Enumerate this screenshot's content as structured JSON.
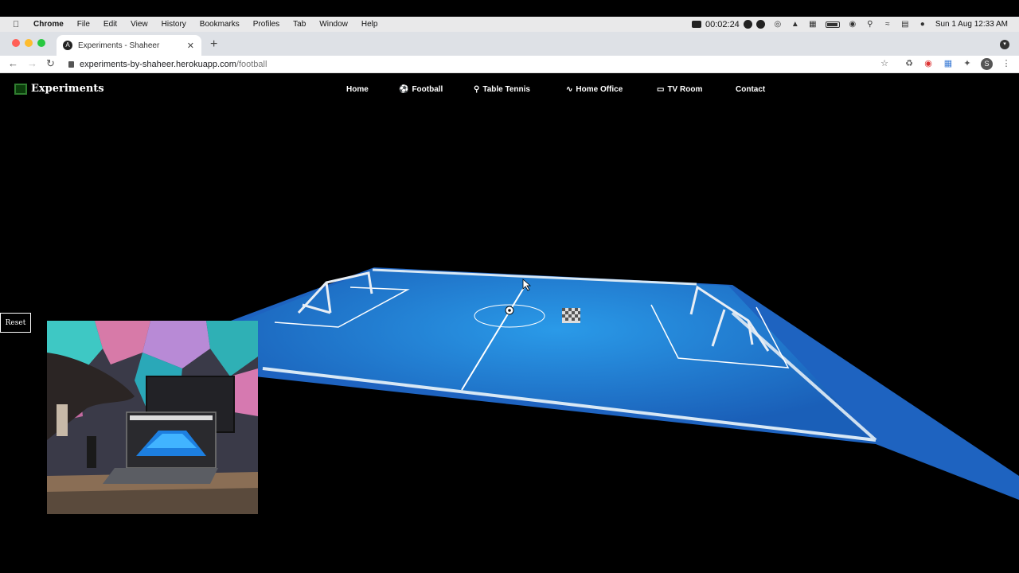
{
  "menubar": {
    "app_name": "Chrome",
    "items": [
      "File",
      "Edit",
      "View",
      "History",
      "Bookmarks",
      "Profiles",
      "Tab",
      "Window",
      "Help"
    ],
    "recording_time": "00:02:24",
    "datetime": "Sun 1 Aug  12:33 AM"
  },
  "browser": {
    "tab_title": "Experiments - Shaheer",
    "url_domain": "experiments-by-shaheer.herokuapp.com",
    "url_path": "/football",
    "profile_initial": "S"
  },
  "site": {
    "logo_text": "Experiments",
    "nav": [
      {
        "label": "Home",
        "icon": ""
      },
      {
        "label": "Football",
        "icon": "football-icon"
      },
      {
        "label": "Table Tennis",
        "icon": "table-tennis-icon"
      },
      {
        "label": "Home Office",
        "icon": "home-office-icon"
      },
      {
        "label": "TV Room",
        "icon": "tv-icon"
      },
      {
        "label": "Contact",
        "icon": ""
      }
    ],
    "reset_label": "Reset"
  },
  "colors": {
    "field_blue": "#1f6fc8",
    "field_light": "#2a8ee0",
    "accent_green": "#2f7d2f"
  }
}
